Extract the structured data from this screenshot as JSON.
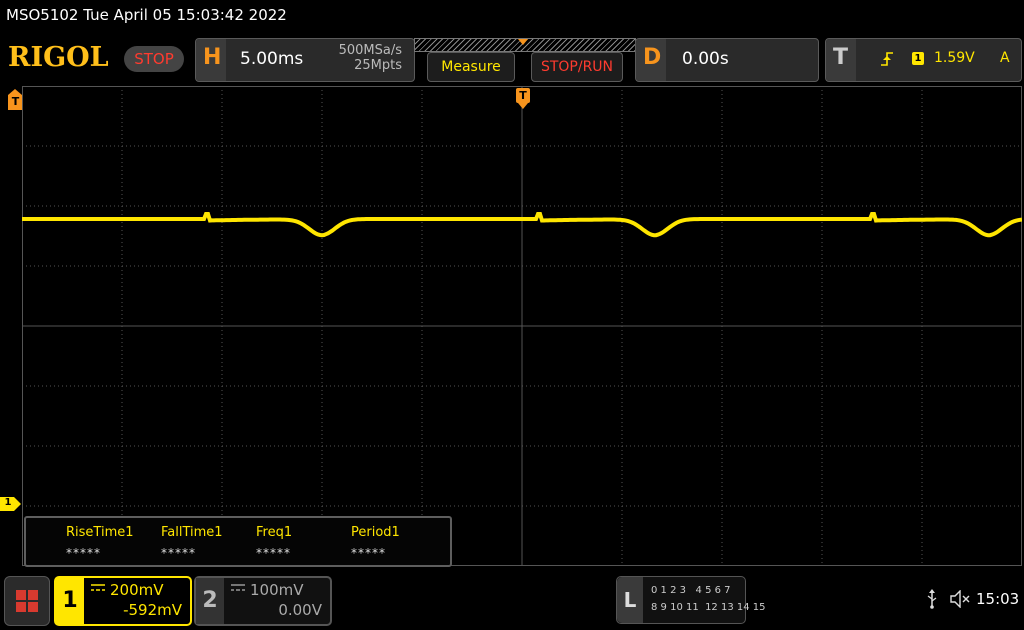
{
  "title_bar": {
    "text": "MSO5102  Tue April 05 15:03:42 2022"
  },
  "logo": "RIGOL",
  "run_state": "STOP",
  "horizontal": {
    "letter": "H",
    "timebase": "5.00ms",
    "sample_rate": "500MSa/s",
    "memory_depth": "25Mpts"
  },
  "buttons": {
    "measure": "Measure",
    "stop_run": "STOP/RUN"
  },
  "delay": {
    "letter": "D",
    "value": "0.00s"
  },
  "trigger": {
    "letter": "T",
    "source": "1",
    "level": "1.59V",
    "mode": "A"
  },
  "markers": {
    "trigger_time": "T",
    "trigger_level": "T",
    "channel1": "1"
  },
  "measurements": [
    {
      "name": "RiseTime1",
      "value": "*****"
    },
    {
      "name": "FallTime1",
      "value": "*****"
    },
    {
      "name": "Freq1",
      "value": "*****"
    },
    {
      "name": "Period1",
      "value": "*****"
    }
  ],
  "channels": [
    {
      "number": "1",
      "scale": "200mV",
      "offset": "-592mV",
      "coupling": "DC"
    },
    {
      "number": "2",
      "scale": "100mV",
      "offset": "0.00V",
      "coupling": "DC"
    }
  ],
  "logic": {
    "letter": "L",
    "row1": "0 1 2 3   4 5 6 7",
    "row2": "8 9 10 11  12 13 14 15"
  },
  "status": {
    "clock": "15:03"
  },
  "colors": {
    "ch1": "#ffe600",
    "accent": "#f7941d",
    "stop": "#ff3b2f",
    "grid": "#555555"
  },
  "icons": {
    "menu": "grid-menu-icon",
    "usb": "usb-icon",
    "sound": "speaker-muted-icon"
  }
}
